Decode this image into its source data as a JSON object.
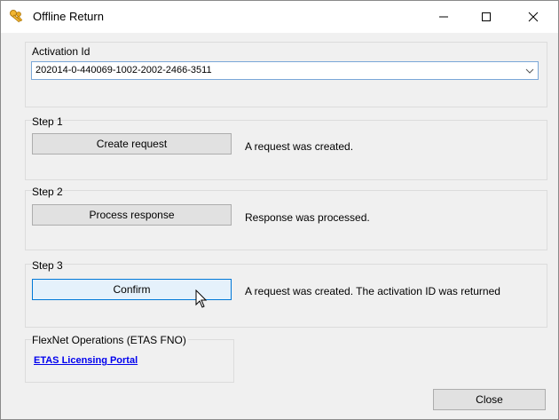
{
  "window": {
    "title": "Offline Return",
    "icon": "keys-icon",
    "controls": {
      "minimize": "minimize-icon",
      "maximize": "maximize-icon",
      "close": "close-icon"
    }
  },
  "activation": {
    "label": "Activation Id",
    "value": "202014-0-440069-1002-2002-2466-3511"
  },
  "steps": [
    {
      "label": "Step 1",
      "button": "Create request",
      "status": "A request was created."
    },
    {
      "label": "Step 2",
      "button": "Process response",
      "status": "Response was processed."
    },
    {
      "label": "Step 3",
      "button": "Confirm",
      "status": "A request was created. The activation ID was returned"
    }
  ],
  "flexnet": {
    "label": "FlexNet Operations (ETAS FNO)",
    "link": "ETAS Licensing Portal"
  },
  "footer": {
    "close_label": "Close"
  },
  "colors": {
    "link": "#0000ee",
    "focus_border": "#0078d7",
    "focus_fill": "#e5f1fb"
  }
}
